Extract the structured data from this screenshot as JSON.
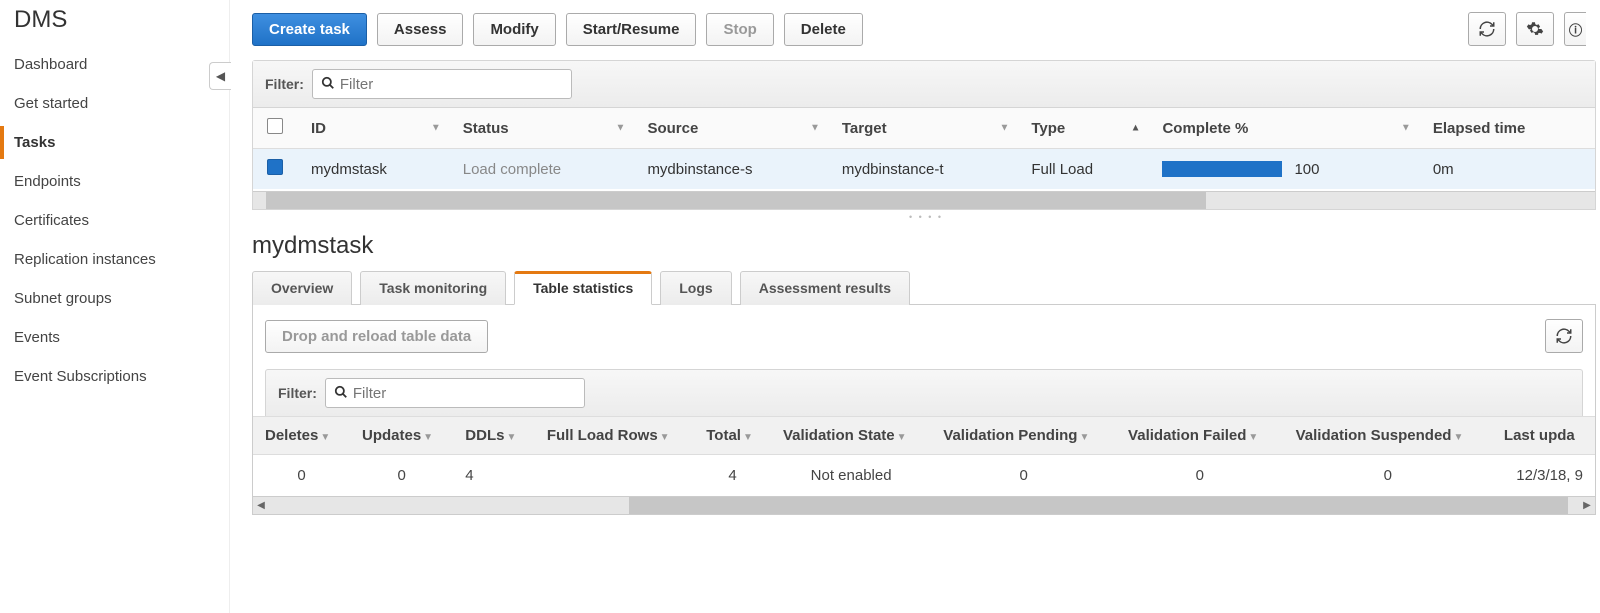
{
  "sidebar": {
    "title": "DMS",
    "items": [
      {
        "label": "Dashboard"
      },
      {
        "label": "Get started"
      },
      {
        "label": "Tasks",
        "active": true
      },
      {
        "label": "Endpoints"
      },
      {
        "label": "Certificates"
      },
      {
        "label": "Replication instances"
      },
      {
        "label": "Subnet groups"
      },
      {
        "label": "Events"
      },
      {
        "label": "Event Subscriptions"
      }
    ]
  },
  "toolbar": {
    "create": "Create task",
    "assess": "Assess",
    "modify": "Modify",
    "start_resume": "Start/Resume",
    "stop": "Stop",
    "delete": "Delete"
  },
  "filter": {
    "label": "Filter:",
    "placeholder": "Filter"
  },
  "task_table": {
    "headers": {
      "id": "ID",
      "status": "Status",
      "source": "Source",
      "target": "Target",
      "type": "Type",
      "complete": "Complete %",
      "elapsed": "Elapsed time"
    },
    "row": {
      "id": "mydmstask",
      "status": "Load complete",
      "source": "mydbinstance-s",
      "target": "mydbinstance-t",
      "type": "Full Load",
      "complete_pct": "100",
      "elapsed": "0m"
    }
  },
  "detail": {
    "title": "mydmstask",
    "tabs": {
      "overview": "Overview",
      "monitoring": "Task monitoring",
      "stats": "Table statistics",
      "logs": "Logs",
      "assessment": "Assessment results"
    },
    "drop_reload": "Drop and reload table data"
  },
  "stats_filter": {
    "label": "Filter:",
    "placeholder": "Filter"
  },
  "stats_table": {
    "headers": {
      "deletes": "Deletes",
      "updates": "Updates",
      "ddls": "DDLs",
      "full_load_rows": "Full Load Rows",
      "total": "Total",
      "validation_state": "Validation State",
      "validation_pending": "Validation Pending",
      "validation_failed": "Validation Failed",
      "validation_suspended": "Validation Suspended",
      "last_updated": "Last upda"
    },
    "row": {
      "deletes": "0",
      "updates": "0",
      "ddls": "4",
      "full_load_rows": "",
      "total": "4",
      "validation_state": "Not enabled",
      "validation_pending": "0",
      "validation_failed": "0",
      "validation_suspended": "0",
      "last_updated": "12/3/18, 9"
    }
  }
}
